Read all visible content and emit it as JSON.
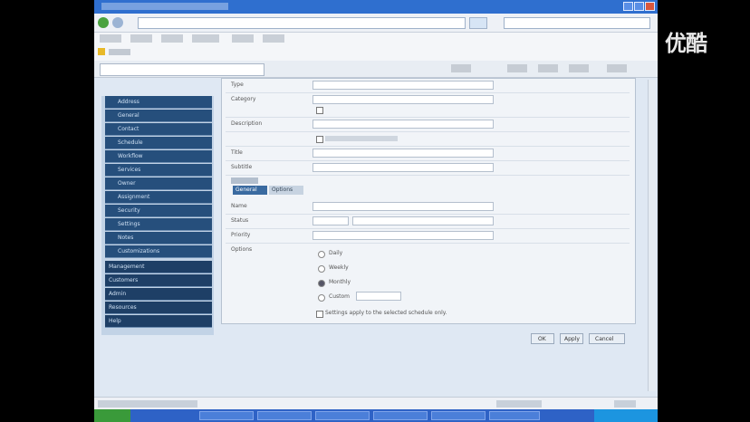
{
  "watermark": {
    "logo_text": "优酷"
  },
  "sidebar": {
    "header_tabs": [
      "Lookups",
      "Resource",
      "Options"
    ],
    "items": [
      {
        "label": "Address"
      },
      {
        "label": "General"
      },
      {
        "label": "Contact"
      },
      {
        "label": "Schedule"
      },
      {
        "label": "Workflow"
      },
      {
        "label": "Services"
      },
      {
        "label": "Owner"
      },
      {
        "label": "Assignment"
      },
      {
        "label": "Security"
      },
      {
        "label": "Settings"
      },
      {
        "label": "Notes"
      },
      {
        "label": "Customizations"
      }
    ],
    "groups": [
      {
        "label": "Management"
      },
      {
        "label": "Customers"
      },
      {
        "label": "Admin"
      },
      {
        "label": "Resources"
      },
      {
        "label": "Help"
      }
    ]
  },
  "form": {
    "rows": [
      {
        "label": "Type"
      },
      {
        "label": "Category"
      },
      {
        "label": "Description"
      },
      {
        "label": ""
      },
      {
        "label": "Title"
      },
      {
        "label": "Subtitle"
      }
    ],
    "subtabs": [
      "General",
      "Options"
    ],
    "lower_rows": [
      {
        "label": "Name"
      },
      {
        "label": "Status"
      },
      {
        "label": "Priority"
      },
      {
        "label": "Options"
      }
    ],
    "radio_options": [
      "Daily",
      "Weekly",
      "Monthly",
      "Custom"
    ],
    "footer_note": "Settings apply to the selected schedule only."
  },
  "buttons": {
    "ok": "OK",
    "apply": "Apply",
    "cancel": "Cancel"
  }
}
